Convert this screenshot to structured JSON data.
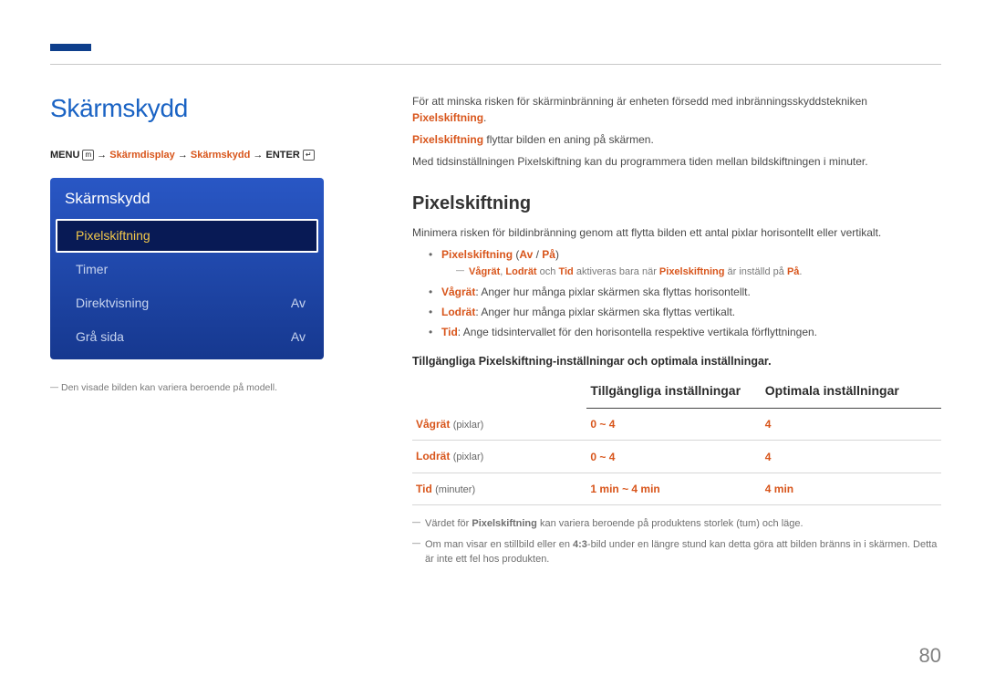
{
  "page_number": "80",
  "left": {
    "title": "Skärmskydd",
    "breadcrumb": {
      "menu": "MENU",
      "p1": "Skärmdisplay",
      "p2": "Skärmskydd",
      "enter": "ENTER"
    },
    "menu": {
      "header": "Skärmskydd",
      "rows": [
        {
          "label": "Pixelskiftning",
          "value": "",
          "selected": true
        },
        {
          "label": "Timer",
          "value": ""
        },
        {
          "label": "Direktvisning",
          "value": "Av"
        },
        {
          "label": "Grå sida",
          "value": "Av"
        }
      ]
    },
    "footnote": "Den visade bilden kan variera beroende på modell."
  },
  "right": {
    "intro1_a": "För att minska risken för skärminbränning är enheten försedd med inbränningsskyddstekniken ",
    "intro1_b": "Pixelskiftning",
    "intro1_c": ".",
    "intro2_a": "Pixelskiftning",
    "intro2_b": " flyttar bilden en aning på skärmen.",
    "intro3": "Med tidsinställningen Pixelskiftning kan du programmera tiden mellan bildskiftningen i minuter.",
    "section": "Pixelskiftning",
    "desc": "Minimera risken för bildinbränning genom att flytta bilden ett antal pixlar horisontellt eller vertikalt.",
    "b1_a": "Pixelskiftning",
    "b1_b": " (",
    "b1_c": "Av",
    "b1_d": " / ",
    "b1_e": "På",
    "b1_f": ")",
    "subnote_a": "Vågrät",
    "subnote_b": ", ",
    "subnote_c": "Lodrät",
    "subnote_d": " och ",
    "subnote_e": "Tid",
    "subnote_f": " aktiveras bara när ",
    "subnote_g": "Pixelskiftning",
    "subnote_h": " är inställd på ",
    "subnote_i": "På",
    "subnote_j": ".",
    "b2_a": "Vågrät",
    "b2_b": ": Anger hur många pixlar skärmen ska flyttas horisontellt.",
    "b3_a": "Lodrät",
    "b3_b": ": Anger hur många pixlar skärmen ska flyttas vertikalt.",
    "b4_a": "Tid",
    "b4_b": ": Ange tidsintervallet för den horisontella respektive vertikala förflyttningen.",
    "table_title": "Tillgängliga Pixelskiftning-inställningar och optimala inställningar.",
    "th1": "",
    "th2": "Tillgängliga inställningar",
    "th3": "Optimala inställningar",
    "rows": [
      {
        "param": "Vågrät",
        "unit": "(pixlar)",
        "avail": "0 ~ 4",
        "optimal": "4"
      },
      {
        "param": "Lodrät",
        "unit": "(pixlar)",
        "avail": "0 ~ 4",
        "optimal": "4"
      },
      {
        "param": "Tid",
        "unit": "(minuter)",
        "avail": "1 min ~ 4 min",
        "optimal": "4 min"
      }
    ],
    "note1_a": "Värdet för ",
    "note1_b": "Pixelskiftning",
    "note1_c": " kan variera beroende på produktens storlek (tum) och läge.",
    "note2_a": "Om man visar en stillbild eller en ",
    "note2_b": "4:3",
    "note2_c": "-bild under en längre stund kan detta göra att bilden bränns in i skärmen. Detta är inte ett fel hos produkten."
  }
}
